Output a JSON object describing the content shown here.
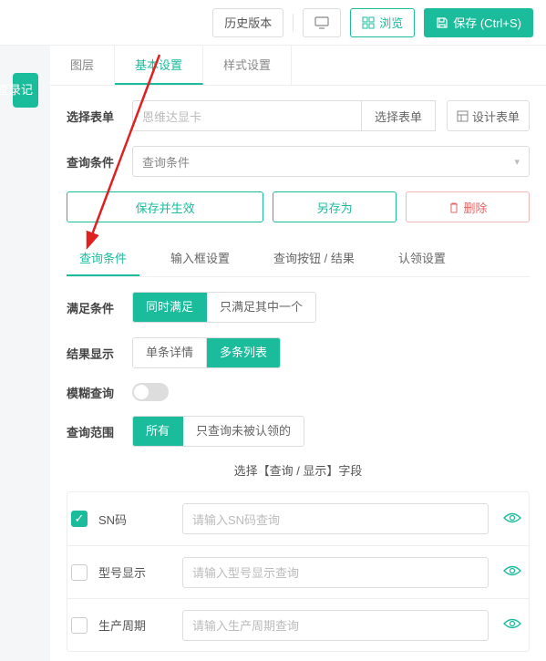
{
  "topbar": {
    "history": "历史版本",
    "preview": "浏览",
    "save": "保存 (Ctrl+S)"
  },
  "side_tab": "记录查询",
  "tabs_main": {
    "t1": "图层",
    "t2": "基本设置",
    "t3": "样式设置"
  },
  "form_select": {
    "label": "选择表单",
    "value": "恩维达显卡",
    "select_btn": "选择表单",
    "design_btn": "设计表单"
  },
  "query_cond": {
    "label": "查询条件",
    "value": "查询条件"
  },
  "actions": {
    "save_apply": "保存并生效",
    "save_as": "另存为",
    "delete": "删除"
  },
  "sub_tabs": {
    "t1": "查询条件",
    "t2": "输入框设置",
    "t3": "查询按钮 / 结果",
    "t4": "认领设置"
  },
  "satisfy": {
    "label": "满足条件",
    "opt1": "同时满足",
    "opt2": "只满足其中一个"
  },
  "result": {
    "label": "结果显示",
    "opt1": "单条详情",
    "opt2": "多条列表"
  },
  "fuzzy": {
    "label": "模糊查询"
  },
  "scope": {
    "label": "查询范围",
    "opt1": "所有",
    "opt2": "只查询未被认领的"
  },
  "fields_title": "选择【查询 / 显示】字段",
  "fields": [
    {
      "name": "SN码",
      "placeholder": "请输入SN码查询",
      "checked": true
    },
    {
      "name": "型号显示",
      "placeholder": "请输入型号显示查询",
      "checked": false
    },
    {
      "name": "生产周期",
      "placeholder": "请输入生产周期查询",
      "checked": false
    }
  ]
}
